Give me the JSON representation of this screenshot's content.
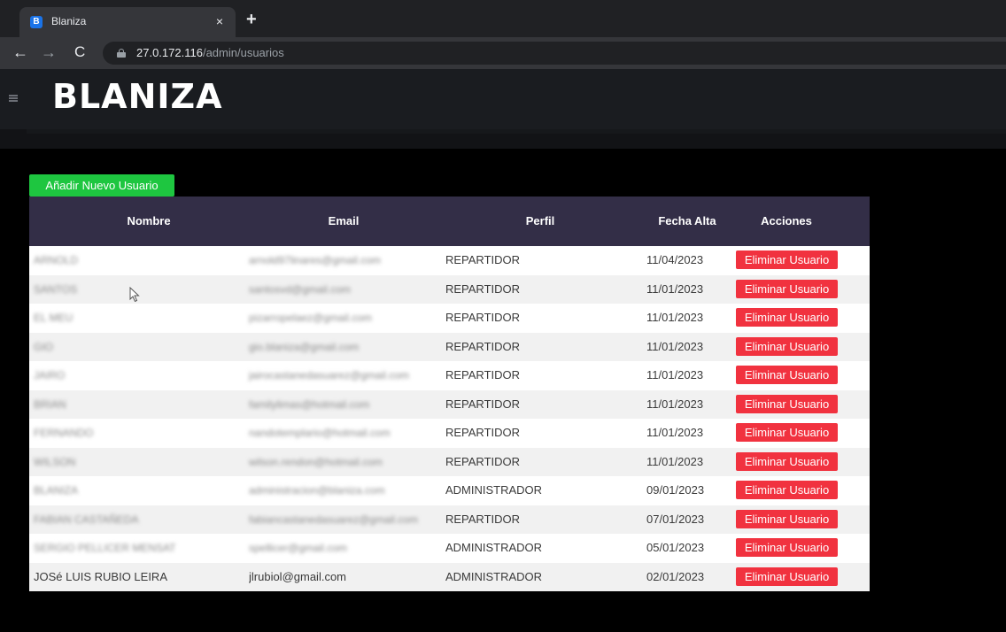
{
  "browser": {
    "tab_title": "Blaniza",
    "favicon_letter": "B",
    "close_glyph": "×",
    "new_tab_glyph": "+",
    "back_glyph": "←",
    "forward_glyph": "→",
    "reload_glyph": "C",
    "url_host": "27.0.172.116",
    "url_path": "/admin/usuarios"
  },
  "header": {
    "brand": "BLANIZA"
  },
  "add_button_label": "Añadir Nuevo Usuario",
  "table": {
    "columns": {
      "nombre": "Nombre",
      "email": "Email",
      "perfil": "Perfil",
      "fecha": "Fecha Alta",
      "acciones": "Acciones"
    },
    "delete_label": "Eliminar Usuario",
    "rows": [
      {
        "nombre": "ARNOLD",
        "email": "arnold97linares@gmail.com",
        "perfil": "REPARTIDOR",
        "fecha": "11/04/2023",
        "blurred": true
      },
      {
        "nombre": "SANTOS",
        "email": "santosvd@gmail.com",
        "perfil": "REPARTIDOR",
        "fecha": "11/01/2023",
        "blurred": true
      },
      {
        "nombre": "EL MEU",
        "email": "pizarropelaez@gmail.com",
        "perfil": "REPARTIDOR",
        "fecha": "11/01/2023",
        "blurred": true
      },
      {
        "nombre": "GIO",
        "email": "gio.blaniza@gmail.com",
        "perfil": "REPARTIDOR",
        "fecha": "11/01/2023",
        "blurred": true
      },
      {
        "nombre": "JAIRO",
        "email": "jairocastanedasuarez@gmail.com",
        "perfil": "REPARTIDOR",
        "fecha": "11/01/2023",
        "blurred": true
      },
      {
        "nombre": "BRIAN",
        "email": "familylimas@hotmail.com",
        "perfil": "REPARTIDOR",
        "fecha": "11/01/2023",
        "blurred": true
      },
      {
        "nombre": "FERNANDO",
        "email": "nandotemplario@hotmail.com",
        "perfil": "REPARTIDOR",
        "fecha": "11/01/2023",
        "blurred": true
      },
      {
        "nombre": "WILSON",
        "email": "wilson.rendon@hotmail.com",
        "perfil": "REPARTIDOR",
        "fecha": "11/01/2023",
        "blurred": true
      },
      {
        "nombre": "BLANIZA",
        "email": "administracion@blaniza.com",
        "perfil": "ADMINISTRADOR",
        "fecha": "09/01/2023",
        "blurred": true
      },
      {
        "nombre": "FABIAN CASTAÑEDA",
        "email": "fabiancastanedasuarez@gmail.com",
        "perfil": "REPARTIDOR",
        "fecha": "07/01/2023",
        "blurred": true
      },
      {
        "nombre": "SERGIO PELLICER MENSAT",
        "email": "spellicer@gmail.com",
        "perfil": "ADMINISTRADOR",
        "fecha": "05/01/2023",
        "blurred": true
      },
      {
        "nombre": "JOSé LUIS RUBIO LEIRA",
        "email": "jlrubiol@gmail.com",
        "perfil": "ADMINISTRADOR",
        "fecha": "02/01/2023",
        "blurred": false
      }
    ]
  },
  "colors": {
    "add_button": "#1ec640",
    "delete_button": "#f1323f",
    "table_header": "#332e47"
  }
}
